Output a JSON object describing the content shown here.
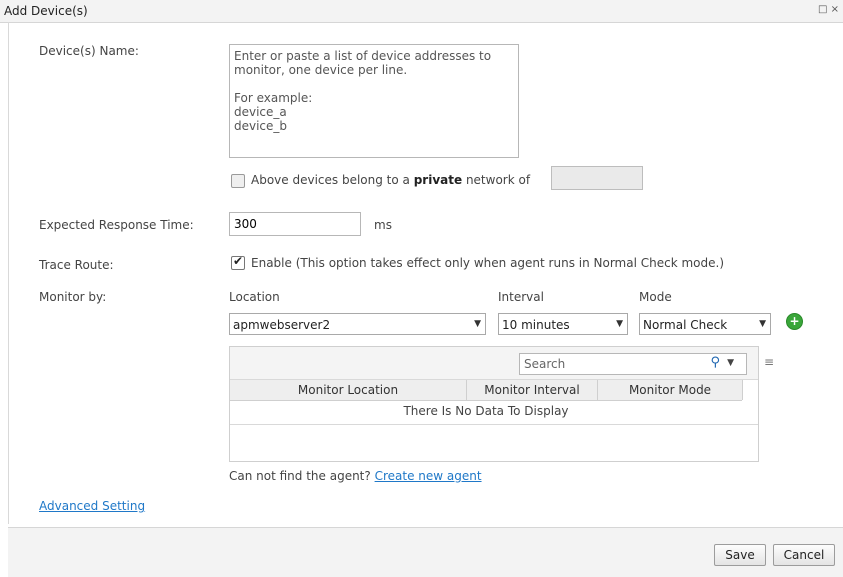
{
  "window": {
    "title": "Add Device(s)",
    "controls": "□ ×"
  },
  "form": {
    "device_name_label": "Device(s) Name:",
    "device_name_placeholder": "Enter or paste a list of device addresses to monitor, one device per line.\n\nFor example:\ndevice_a\ndevice_b",
    "private_network": {
      "checked": false,
      "prefix": "Above devices belong to a ",
      "bold": "private",
      "suffix": " network of",
      "value": ""
    },
    "response_time": {
      "label": "Expected Response Time:",
      "value": "300",
      "unit": "ms"
    },
    "trace_route": {
      "label": "Trace Route:",
      "checked": true,
      "text": "Enable (This option takes effect only when agent runs in Normal Check mode.)"
    },
    "monitor_by": {
      "label": "Monitor by:",
      "location_label": "Location",
      "interval_label": "Interval",
      "mode_label": "Mode",
      "location_value": "apmwebserver2",
      "interval_value": "10 minutes",
      "mode_value": "Normal Check"
    }
  },
  "grid": {
    "search_placeholder": "Search",
    "columns": [
      "Monitor Location",
      "Monitor Interval",
      "Monitor Mode"
    ],
    "empty_text": "There Is No Data To Display"
  },
  "agent_hint": {
    "text": "Can not find the agent? ",
    "link": "Create new agent"
  },
  "advanced_link": "Advanced Setting",
  "buttons": {
    "save": "Save",
    "cancel": "Cancel"
  },
  "icons": {
    "add": "add-circle-icon",
    "search": "magnifier-icon",
    "dropdown": "chevron-down-icon",
    "columns": "column-menu-icon"
  },
  "colors": {
    "link": "#1f78c8",
    "add_button": "#3aa63a"
  }
}
